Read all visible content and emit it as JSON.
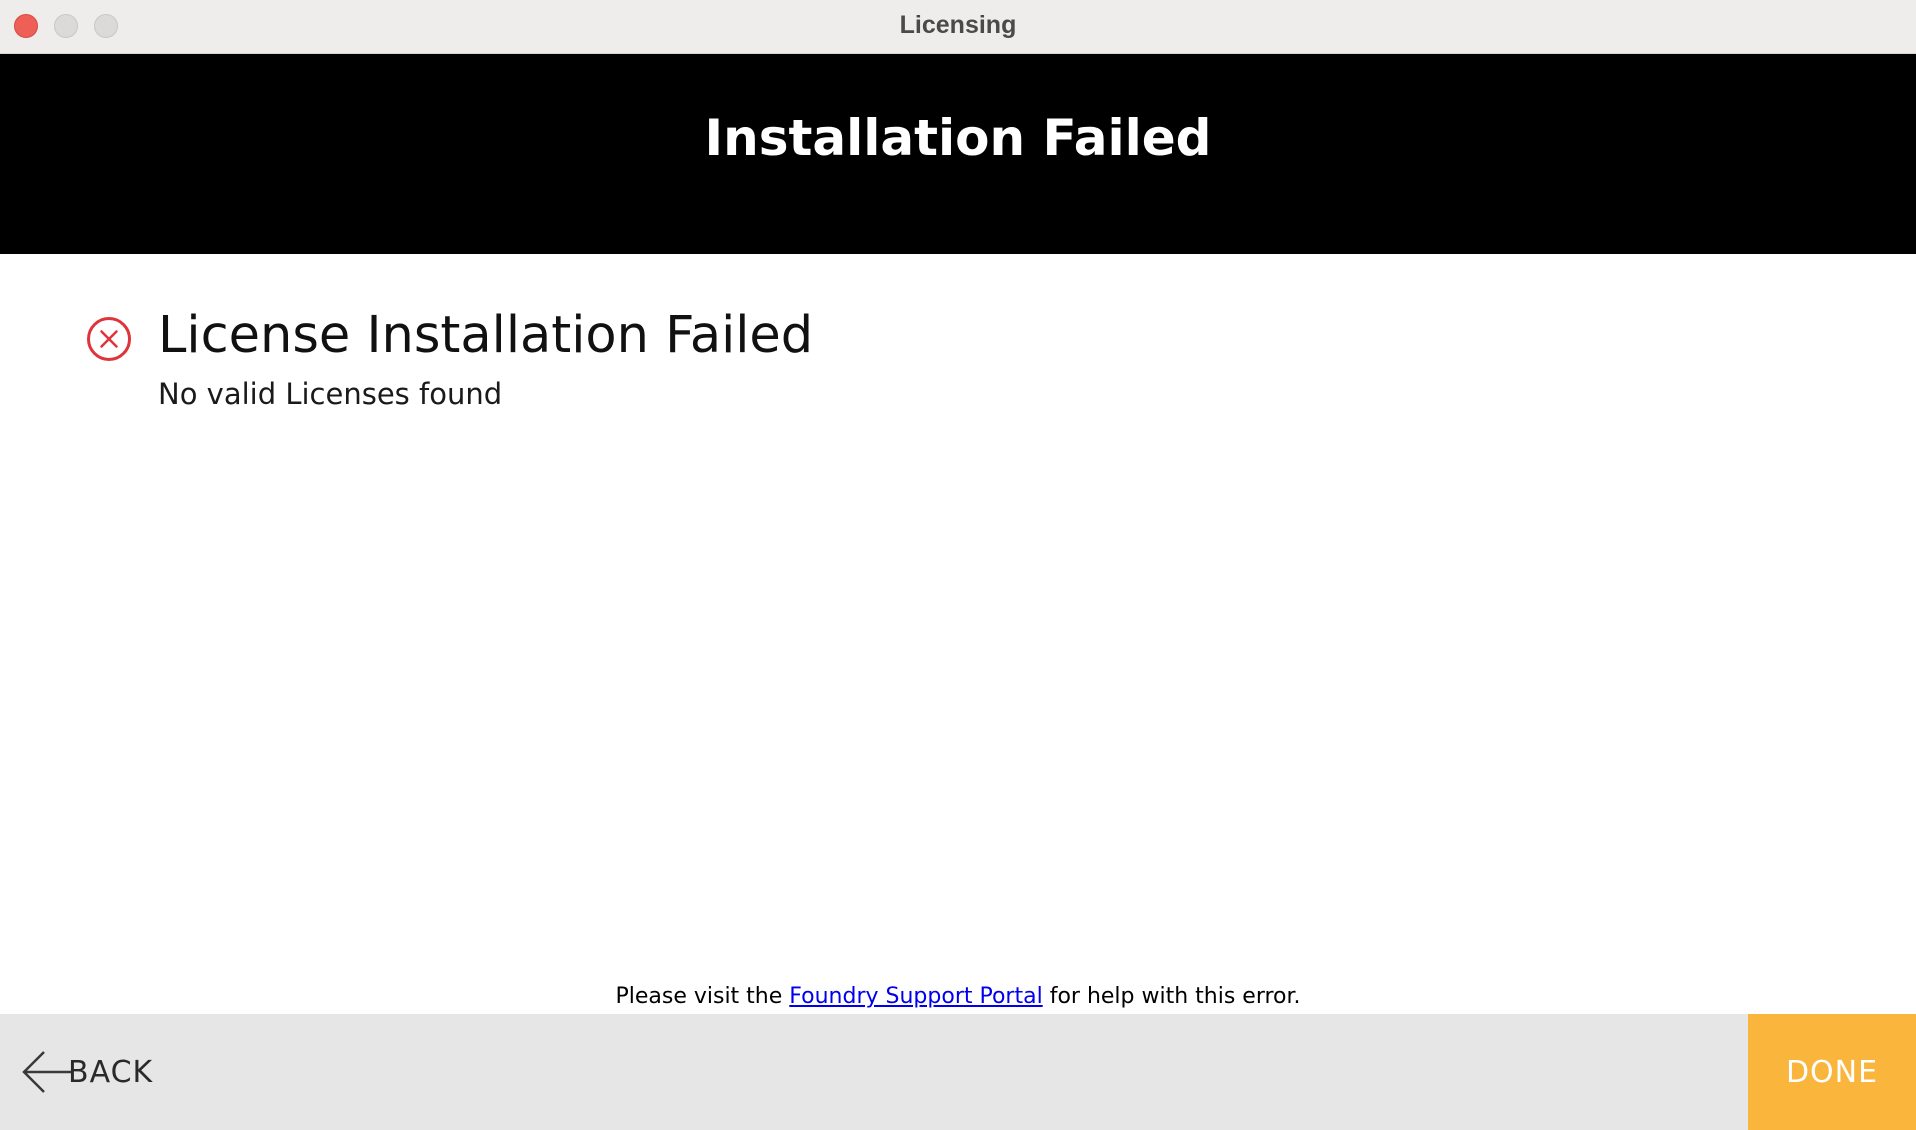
{
  "window": {
    "title": "Licensing"
  },
  "banner": {
    "title": "Installation Failed"
  },
  "status": {
    "icon": "error-circle-x-icon",
    "icon_color": "#e0343b",
    "title": "License Installation Failed",
    "detail": "No valid Licenses found"
  },
  "help": {
    "prefix": "Please visit the ",
    "link_text": "Foundry Support Portal",
    "suffix": " for help with this error."
  },
  "footer": {
    "back_label": "BACK",
    "done_label": "DONE",
    "done_color": "#f9b53c"
  }
}
